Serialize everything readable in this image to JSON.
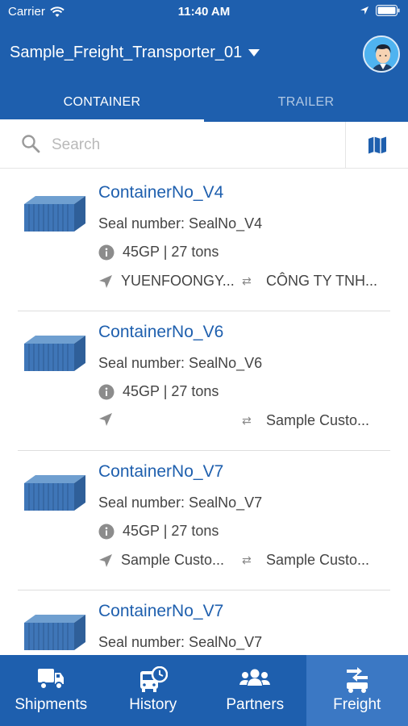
{
  "status_bar": {
    "carrier": "Carrier",
    "time": "11:40 AM"
  },
  "header": {
    "title": "Sample_Freight_Transporter_01"
  },
  "tabs": [
    {
      "label": "CONTAINER",
      "active": true
    },
    {
      "label": "TRAILER",
      "active": false
    }
  ],
  "search": {
    "placeholder": "Search",
    "value": ""
  },
  "containers": [
    {
      "name": "ContainerNo_V4",
      "seal": "Seal number: SealNo_V4",
      "spec": "45GP | 27 tons",
      "from": "YUENFOONGY...",
      "to": "CÔNG TY TNH..."
    },
    {
      "name": "ContainerNo_V6",
      "seal": "Seal number: SealNo_V6",
      "spec": "45GP | 27 tons",
      "from": "",
      "to": "Sample Custo..."
    },
    {
      "name": "ContainerNo_V7",
      "seal": "Seal number: SealNo_V7",
      "spec": "45GP | 27 tons",
      "from": "Sample Custo...",
      "to": "Sample Custo..."
    },
    {
      "name": "ContainerNo_V7",
      "seal": "Seal number: SealNo_V7",
      "spec": "",
      "from": "",
      "to": ""
    }
  ],
  "bottom_nav": [
    {
      "label": "Shipments",
      "icon": "truck-icon",
      "active": false
    },
    {
      "label": "History",
      "icon": "history-bus-icon",
      "active": false
    },
    {
      "label": "Partners",
      "icon": "partners-group-icon",
      "active": false
    },
    {
      "label": "Freight",
      "icon": "freight-icon",
      "active": true
    }
  ],
  "colors": {
    "primary": "#1e5fae",
    "active_nav": "#3b78c4",
    "link": "#1e5fae"
  }
}
